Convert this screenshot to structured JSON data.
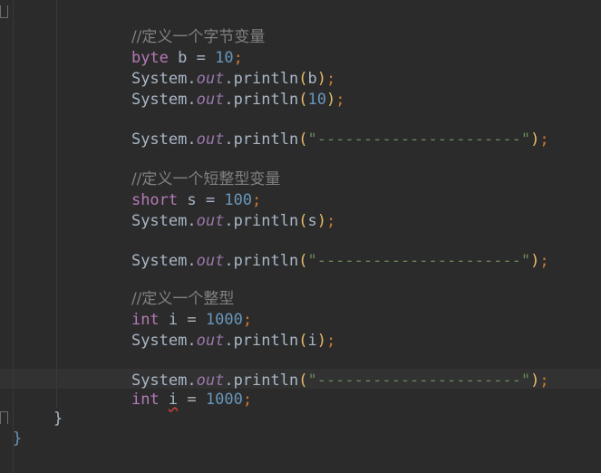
{
  "code": {
    "comment1": "//定义一个字节变量",
    "byte_kw": "byte",
    "byte_decl": " b = ",
    "byte_val": "10",
    "sys": "System.",
    "out": "out",
    "println": ".println",
    "arg_b": "b",
    "arg_10": "10",
    "dashes": "\"----------------------\"",
    "comment2": "//定义一个短整型变量",
    "short_kw": "short",
    "short_decl": " s = ",
    "short_val": "100",
    "arg_s": "s",
    "comment3": "//定义一个整型",
    "int_kw": "int",
    "int_decl": " i = ",
    "int_val": "1000",
    "arg_i": "i",
    "int2_space": " ",
    "int2_var": "i",
    "int2_eq": " = ",
    "int2_val": "1000",
    "semicolon": ";",
    "lparen": "(",
    "rparen": ")",
    "close_brace_inner": "}",
    "close_brace_outer": "}"
  },
  "colors": {
    "background": "#2b2b2b",
    "keyword": "#cc7832",
    "number": "#6897bb",
    "string": "#6a8759",
    "comment": "#808080",
    "field": "#9876aa"
  }
}
